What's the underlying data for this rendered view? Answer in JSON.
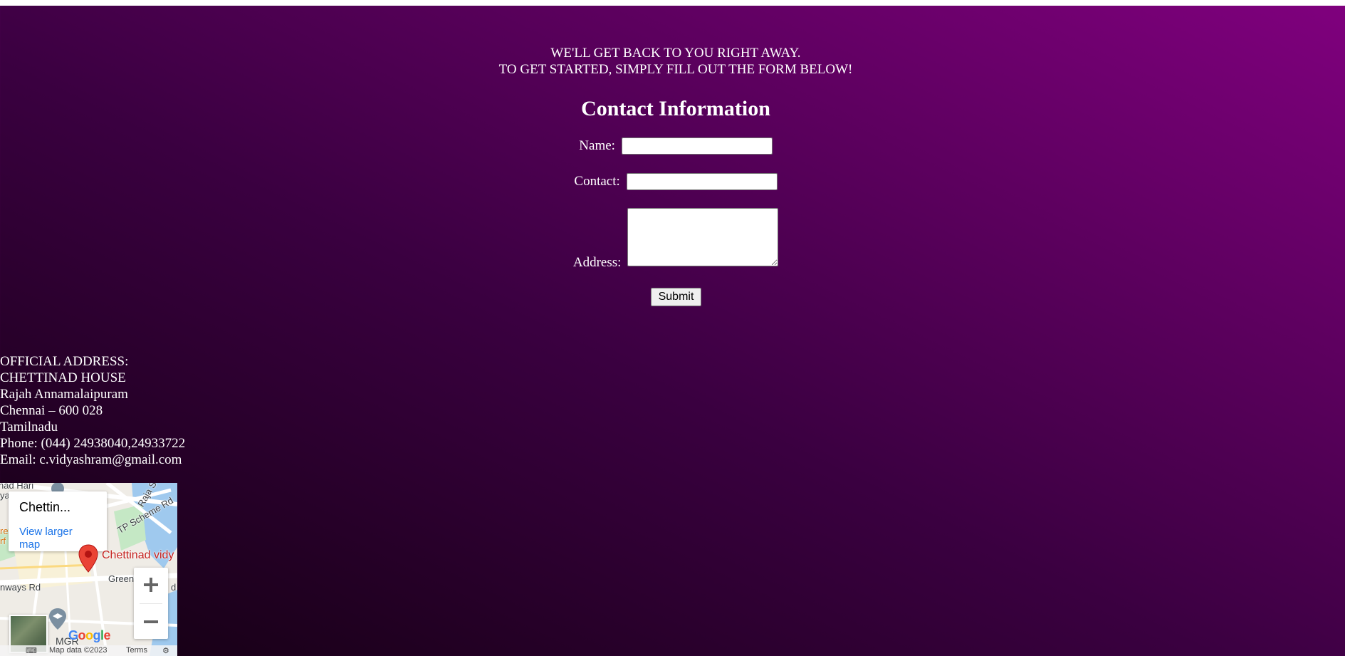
{
  "intro": {
    "line1": "WE'LL GET BACK TO YOU RIGHT AWAY.",
    "line2": "TO GET STARTED, SIMPLY FILL OUT THE FORM BELOW!"
  },
  "form": {
    "title": "Contact Information",
    "name_label": "Name:",
    "name_value": "",
    "contact_label": "Contact:",
    "contact_value": "",
    "address_label": "Address:",
    "address_value": "",
    "submit_label": "Submit"
  },
  "official_address": {
    "heading": "OFFICIAL ADDRESS:",
    "lines": [
      "CHETTINAD HOUSE",
      "Rajah Annamalaipuram",
      "Chennai – 600 028",
      "Tamilnadu",
      "Phone: (044) 24938040,24933722",
      "Email: c.vidyashram@gmail.com"
    ]
  },
  "map": {
    "place_name": "Chettin...",
    "view_larger": "View larger map",
    "pin_label": "Chettinad vidy",
    "road_labels": {
      "scheme_rd": "TP Scheme Rd",
      "raja": "Raja S",
      "greenways": "Green",
      "ways_rd": "nways Rd",
      "d": "d",
      "hari": "nad Hari",
      "ya": "ya",
      "re": "re",
      "rf": "rf"
    },
    "mgr": "MGR",
    "google": "Google",
    "map_data": "Map data ©2023",
    "terms": "Terms",
    "zoom_in": "+",
    "zoom_out": "−",
    "colors": {
      "pin": "#ea4335",
      "link": "#1a73e8",
      "water": "#9fc9ee",
      "park": "#c5e8c5"
    }
  }
}
